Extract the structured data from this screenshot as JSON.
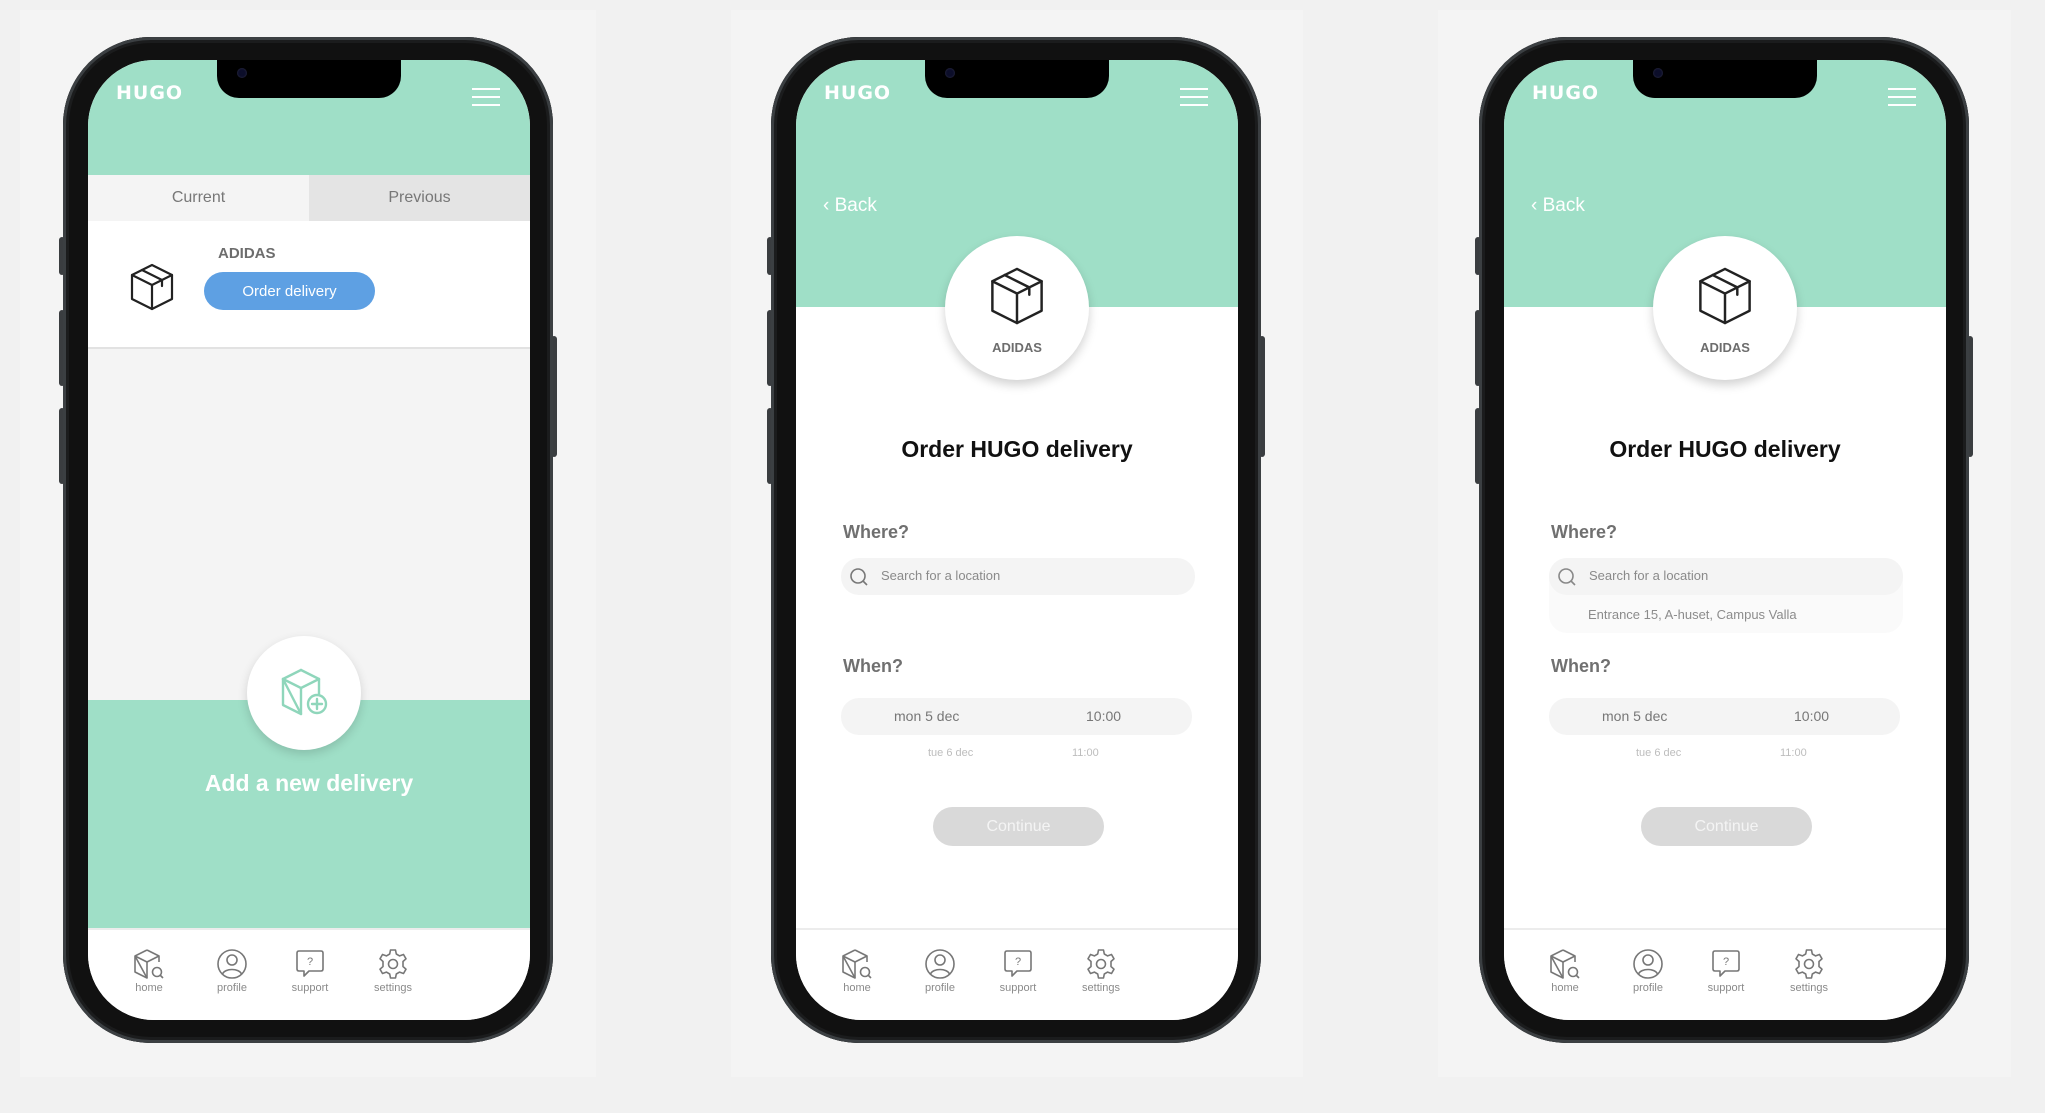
{
  "app": {
    "logo": "HUGO"
  },
  "colors": {
    "accent_green": "#9fdfc7",
    "primary_blue": "#5ea0e3",
    "disabled_gray": "#d9d9d9"
  },
  "nav": [
    {
      "label": "home",
      "icon": "package-search-icon"
    },
    {
      "label": "profile",
      "icon": "user-circle-icon"
    },
    {
      "label": "support",
      "icon": "help-chat-icon"
    },
    {
      "label": "settings",
      "icon": "gear-icon"
    }
  ],
  "screen1": {
    "tabs": [
      {
        "label": "Current",
        "active": true
      },
      {
        "label": "Previous",
        "active": false
      }
    ],
    "card": {
      "brand": "ADIDAS",
      "button": "Order delivery"
    },
    "add": {
      "label": "Add a new delivery"
    }
  },
  "screen2": {
    "back": "Back",
    "brand": "ADIDAS",
    "title": "Order HUGO delivery",
    "where_label": "Where?",
    "search_placeholder": "Search for a location",
    "when_label": "When?",
    "date": "mon 5 dec",
    "time": "10:00",
    "next_date": "tue 6 dec",
    "next_time": "11:00",
    "continue": "Continue"
  },
  "screen3": {
    "back": "Back",
    "brand": "ADIDAS",
    "title": "Order HUGO delivery",
    "where_label": "Where?",
    "search_placeholder": "Search for a location",
    "suggestion": "Entrance 15, A-huset, Campus Valla",
    "when_label": "When?",
    "date": "mon 5 dec",
    "time": "10:00",
    "next_date": "tue 6 dec",
    "next_time": "11:00",
    "continue": "Continue"
  }
}
